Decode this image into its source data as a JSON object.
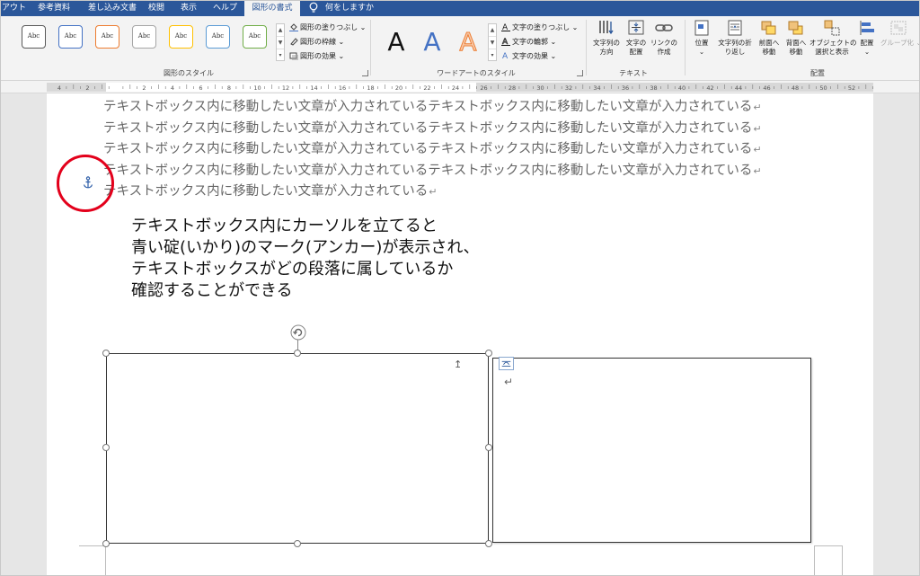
{
  "tabs": [
    {
      "label": "アウト",
      "active": false
    },
    {
      "label": "参考資料",
      "active": false
    },
    {
      "label": "差し込み文書",
      "active": false
    },
    {
      "label": "校閲",
      "active": false
    },
    {
      "label": "表示",
      "active": false
    },
    {
      "label": "ヘルプ",
      "active": false
    },
    {
      "label": "図形の書式",
      "active": true
    }
  ],
  "tell_me": "何をしますか",
  "ribbon": {
    "shape_styles": {
      "gallery": [
        "Abc",
        "Abc",
        "Abc",
        "Abc",
        "Abc",
        "Abc",
        "Abc"
      ],
      "gallery_colors": [
        "#595959",
        "#4472c4",
        "#ed7d31",
        "#a5a5a5",
        "#ffc000",
        "#5b9bd5",
        "#70ad47"
      ],
      "fill": "図形の塗りつぶし",
      "outline": "図形の枠線",
      "effects": "図形の効果",
      "label": "図形のスタイル"
    },
    "wordart": {
      "letters": [
        "A",
        "A",
        "A"
      ],
      "text_fill": "文字の塗りつぶし",
      "text_outline": "文字の輪郭",
      "text_effects": "文字の効果",
      "label": "ワードアートのスタイル"
    },
    "text_group": {
      "direction": "文字列の\n方向",
      "align": "文字の\n配置",
      "link": "リンクの\n作成",
      "label": "テキスト"
    },
    "arrange": {
      "position": "位置",
      "wrap": "文字列の折\nり返し",
      "forward": "前面へ\n移動",
      "backward": "背面へ\n移動",
      "selection_pane": "オブジェクトの\n選択と表示",
      "align": "配置",
      "group": "グループ化",
      "label": "配置"
    }
  },
  "ruler": {
    "numbers": [
      "4",
      "2",
      "",
      "2",
      "4",
      "6",
      "8",
      "10",
      "12",
      "14",
      "16",
      "18",
      "20",
      "22",
      "24",
      "26",
      "28",
      "30",
      "32",
      "34",
      "36",
      "38",
      "40",
      "42",
      "44",
      "46",
      "48",
      "50",
      "52"
    ]
  },
  "document": {
    "lines": [
      "テキストボックス内に移動したい文章が入力されているテキストボックス内に移動したい文章が入力されている",
      "テキストボックス内に移動したい文章が入力されているテキストボックス内に移動したい文章が入力されている",
      "テキストボックス内に移動したい文章が入力されているテキストボックス内に移動したい文章が入力されている",
      "テキストボックス内に移動したい文章が入力されているテキストボックス内に移動したい文章が入力されている",
      "テキストボックス内に移動したい文章が入力されている"
    ],
    "para_mark": "↵",
    "callout": [
      "テキストボックス内にカーソルを立てると",
      "青い碇(いかり)のマーク(アンカー)が表示され、",
      "テキストボックスがどの段落に属しているか",
      "確認することができる"
    ]
  },
  "colors": {
    "accent": "#2b579a",
    "annotation": "#e3001b",
    "anchor": "#2e5ea8"
  }
}
